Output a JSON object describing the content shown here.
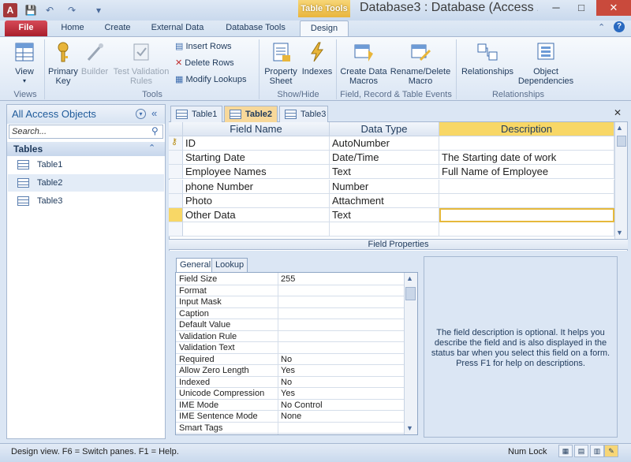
{
  "window": {
    "context_tab": "Table Tools",
    "title": "Database3 : Database (Access 20…",
    "min": "─",
    "max": "□",
    "close": "✕"
  },
  "app_icon_letter": "A",
  "qat": [
    "💾",
    "↶",
    "↷",
    "▾"
  ],
  "tabs": [
    "File",
    "Home",
    "Create",
    "External Data",
    "Database Tools",
    "Design"
  ],
  "help_icon": "?",
  "ribbon": {
    "views": {
      "label": "View",
      "group": "Views"
    },
    "tools": {
      "primary_key": "Primary Key",
      "builder": "Builder",
      "test_validation": "Test Validation Rules",
      "insert_rows": "Insert Rows",
      "delete_rows": "Delete Rows",
      "modify_lookups": "Modify Lookups",
      "group": "Tools"
    },
    "show_hide": {
      "property_sheet": "Property Sheet",
      "indexes": "Indexes",
      "group": "Show/Hide"
    },
    "events": {
      "create_data_macros": "Create Data Macros",
      "rename_delete_macro": "Rename/Delete Macro",
      "group": "Field, Record & Table Events"
    },
    "relationships": {
      "relationships": "Relationships",
      "object_dependencies": "Object Dependencies",
      "group": "Relationships"
    }
  },
  "nav": {
    "title": "All Access Objects",
    "search_placeholder": "Search...",
    "section": "Tables",
    "items": [
      "Table1",
      "Table2",
      "Table3"
    ],
    "selected": "Table2"
  },
  "doc_tabs": [
    "Table1",
    "Table2",
    "Table3"
  ],
  "active_tab": "Table2",
  "grid": {
    "headers": [
      "Field Name",
      "Data Type",
      "Description"
    ],
    "rows": [
      {
        "name": "ID",
        "type": "AutoNumber",
        "desc": "",
        "key": true
      },
      {
        "name": "Starting Date",
        "type": "Date/Time",
        "desc": "The Starting date of work"
      },
      {
        "name": "Employee Names",
        "type": "Text",
        "desc": "Full Name of Employee"
      },
      {
        "name": "phone Number",
        "type": "Number",
        "desc": ""
      },
      {
        "name": "Photo",
        "type": "Attachment",
        "desc": ""
      },
      {
        "name": "Other Data",
        "type": "Text",
        "desc": "",
        "current": true
      },
      {
        "name": "",
        "type": "",
        "desc": ""
      }
    ]
  },
  "field_properties": {
    "title": "Field Properties",
    "tabs": [
      "General",
      "Lookup"
    ],
    "rows": [
      [
        "Field Size",
        "255"
      ],
      [
        "Format",
        ""
      ],
      [
        "Input Mask",
        ""
      ],
      [
        "Caption",
        ""
      ],
      [
        "Default Value",
        ""
      ],
      [
        "Validation Rule",
        ""
      ],
      [
        "Validation Text",
        ""
      ],
      [
        "Required",
        "No"
      ],
      [
        "Allow Zero Length",
        "Yes"
      ],
      [
        "Indexed",
        "No"
      ],
      [
        "Unicode Compression",
        "Yes"
      ],
      [
        "IME Mode",
        "No Control"
      ],
      [
        "IME Sentence Mode",
        "None"
      ],
      [
        "Smart Tags",
        ""
      ]
    ],
    "help": "The field description is optional. It helps you describe the field and is also displayed in the status bar when you select this field on a form. Press F1 for help on descriptions."
  },
  "status": {
    "left": "Design view.  F6 = Switch panes.  F1 = Help.",
    "num_lock": "Num Lock"
  },
  "colors": {
    "accent": "#f8d766",
    "file_tab": "#b5222f"
  }
}
